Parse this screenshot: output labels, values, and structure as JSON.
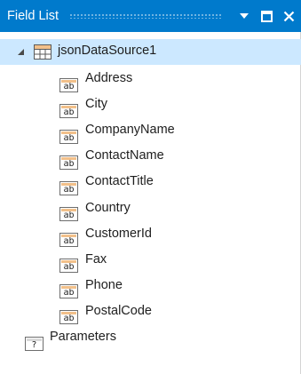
{
  "window": {
    "title": "Field List",
    "buttons": [
      "dropdown-icon",
      "maximize-icon",
      "close-icon"
    ]
  },
  "tree": {
    "root": {
      "label": "jsonDataSource1",
      "icon": "table-icon",
      "expanded": true
    },
    "fields": [
      {
        "label": "Address",
        "icon": "string-field-icon",
        "icon_text": "ab"
      },
      {
        "label": "City",
        "icon": "string-field-icon",
        "icon_text": "ab"
      },
      {
        "label": "CompanyName",
        "icon": "string-field-icon",
        "icon_text": "ab"
      },
      {
        "label": "ContactName",
        "icon": "string-field-icon",
        "icon_text": "ab"
      },
      {
        "label": "ContactTitle",
        "icon": "string-field-icon",
        "icon_text": "ab"
      },
      {
        "label": "Country",
        "icon": "string-field-icon",
        "icon_text": "ab"
      },
      {
        "label": "CustomerId",
        "icon": "string-field-icon",
        "icon_text": "ab"
      },
      {
        "label": "Fax",
        "icon": "string-field-icon",
        "icon_text": "ab"
      },
      {
        "label": "Phone",
        "icon": "string-field-icon",
        "icon_text": "ab"
      },
      {
        "label": "PostalCode",
        "icon": "string-field-icon",
        "icon_text": "ab"
      }
    ],
    "parameters": {
      "label": "Parameters",
      "icon": "parameter-icon",
      "icon_text": "?"
    }
  },
  "colors": {
    "titlebar": "#007acc",
    "selection": "#cce8ff",
    "field_icon_band": "#f2c08a"
  }
}
